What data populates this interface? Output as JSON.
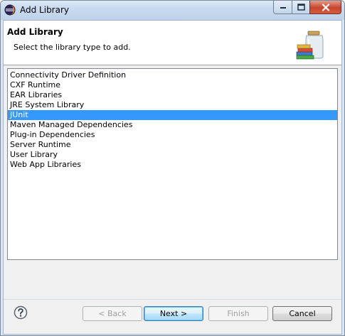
{
  "window": {
    "title": "Add Library"
  },
  "header": {
    "title": "Add Library",
    "description": "Select the library type to add.",
    "icon": "library-jar-books-icon"
  },
  "library_list": {
    "items": [
      {
        "label": "Connectivity Driver Definition",
        "selected": false
      },
      {
        "label": "CXF Runtime",
        "selected": false
      },
      {
        "label": "EAR Libraries",
        "selected": false
      },
      {
        "label": "JRE System Library",
        "selected": false
      },
      {
        "label": "JUnit",
        "selected": true
      },
      {
        "label": "Maven Managed Dependencies",
        "selected": false
      },
      {
        "label": "Plug-in Dependencies",
        "selected": false
      },
      {
        "label": "Server Runtime",
        "selected": false
      },
      {
        "label": "User Library",
        "selected": false
      },
      {
        "label": "Web App Libraries",
        "selected": false
      }
    ]
  },
  "buttons": {
    "back": "< Back",
    "next": "Next >",
    "finish": "Finish",
    "cancel": "Cancel"
  },
  "colors": {
    "selection": "#3399ff",
    "titlebar": "#c7d9ee",
    "close_button": "#c8452c"
  }
}
